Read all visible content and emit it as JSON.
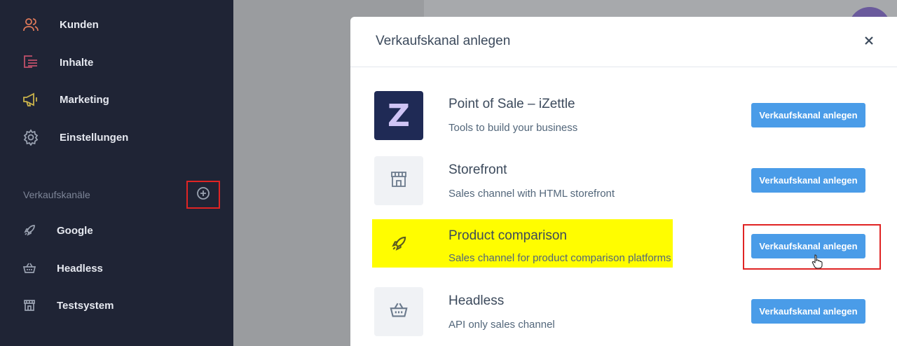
{
  "sidebar": {
    "nav": [
      {
        "label": "Kunden",
        "icon": "users-icon"
      },
      {
        "label": "Inhalte",
        "icon": "content-list-icon"
      },
      {
        "label": "Marketing",
        "icon": "megaphone-icon"
      },
      {
        "label": "Einstellungen",
        "icon": "gear-icon"
      }
    ],
    "section_label": "Verkaufskanäle",
    "channels": [
      {
        "label": "Google",
        "icon": "rocket-icon"
      },
      {
        "label": "Headless",
        "icon": "basket-icon"
      },
      {
        "label": "Testsystem",
        "icon": "storefront-icon"
      }
    ]
  },
  "modal": {
    "title": "Verkaufskanal anlegen",
    "rows": [
      {
        "title": "Point of Sale – iZettle",
        "description": "Tools to build your business",
        "button": "Verkaufskanal anlegen",
        "tile_letter": "Z",
        "icon": "izettle-logo"
      },
      {
        "title": "Storefront",
        "description": "Sales channel with HTML storefront",
        "button": "Verkaufskanal anlegen",
        "icon": "storefront-icon"
      },
      {
        "title": "Product comparison",
        "description": "Sales channel for product comparison platforms",
        "button": "Verkaufskanal anlegen",
        "icon": "rocket-icon"
      },
      {
        "title": "Headless",
        "description": "API only sales channel",
        "button": "Verkaufskanal anlegen",
        "icon": "basket-icon"
      }
    ]
  },
  "colors": {
    "sidebar_bg": "#1f2435",
    "accent_button": "#4a9ce8",
    "highlight": "#fffd00",
    "annotation_red": "#e02424",
    "izettle_tile": "#1f2a55"
  }
}
